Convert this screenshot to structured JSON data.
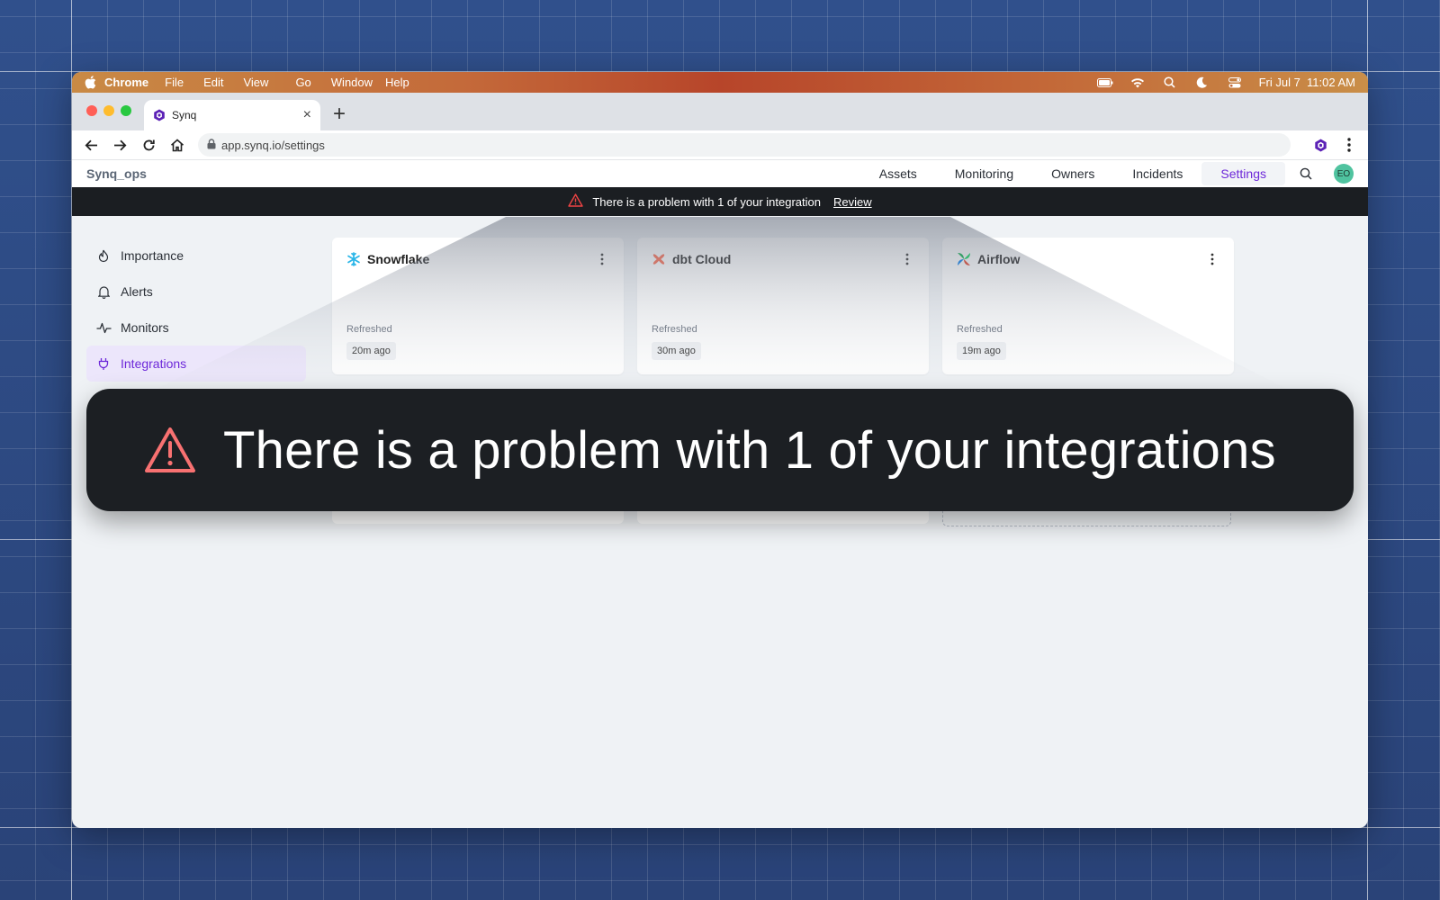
{
  "menubar": {
    "app": "Chrome",
    "items": [
      "File",
      "Edit",
      "View",
      "Go",
      "Window",
      "Help"
    ],
    "clock": "Fri Jul 7  11:02 AM"
  },
  "browser": {
    "tab_title": "Synq",
    "url": "app.synq.io/settings"
  },
  "app": {
    "workspace": "Synq_ops",
    "nav": [
      "Assets",
      "Monitoring",
      "Owners",
      "Incidents",
      "Settings"
    ],
    "active_nav": "Settings",
    "avatar_initials": "EO",
    "accent_color": "#6d28d9"
  },
  "banner": {
    "message": "There is a problem with 1 of your integration",
    "action": "Review"
  },
  "sidebar": {
    "items": [
      {
        "label": "Importance",
        "icon": "flame-icon"
      },
      {
        "label": "Alerts",
        "icon": "bell-icon"
      },
      {
        "label": "Monitors",
        "icon": "pulse-icon"
      },
      {
        "label": "Integrations",
        "icon": "plug-icon"
      }
    ],
    "active": "Integrations"
  },
  "integrations": [
    {
      "name": "Snowflake",
      "refreshed_label": "Refreshed",
      "refreshed": "20m ago",
      "icon": "snowflake-icon"
    },
    {
      "name": "dbt Cloud",
      "refreshed_label": "Refreshed",
      "refreshed": "30m ago",
      "icon": "dbt-icon"
    },
    {
      "name": "Airflow",
      "refreshed_label": "Refreshed",
      "refreshed": "19m ago",
      "icon": "airflow-icon"
    }
  ],
  "callout": {
    "message": "There is a problem with 1 of your integrations"
  }
}
